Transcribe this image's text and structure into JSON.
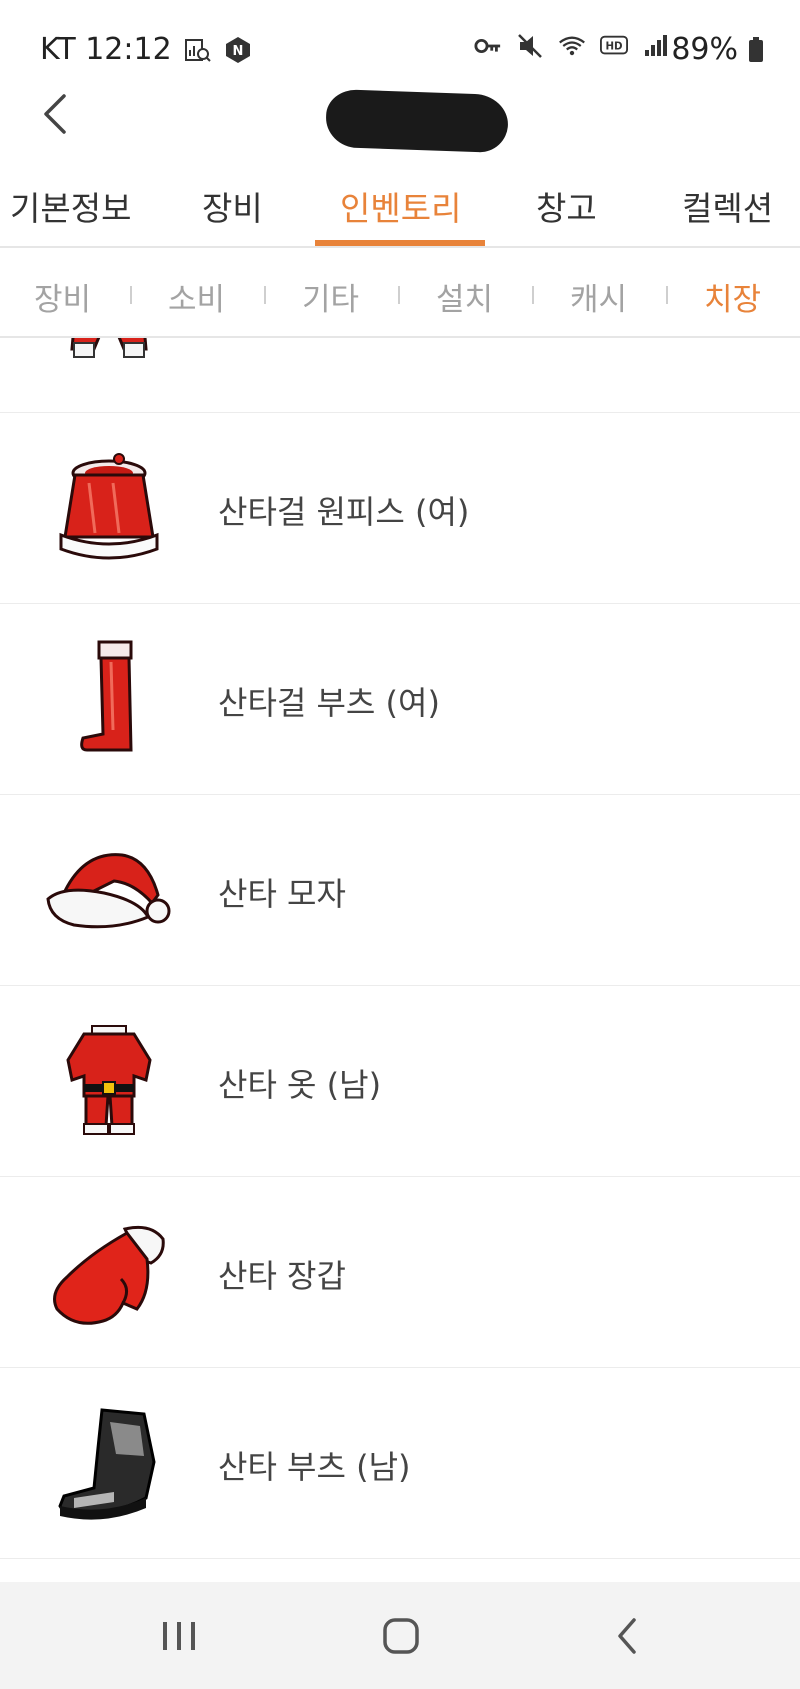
{
  "status_bar": {
    "carrier_time": "KT 12:12",
    "battery_percent": "89%",
    "left_icons": [
      "chart-search-icon",
      "naver-n-icon"
    ],
    "right_icons": [
      "key-icon",
      "mute-icon",
      "wifi-icon",
      "hd-icon",
      "signal-icon",
      "battery-icon"
    ]
  },
  "header": {
    "back_icon": "chevron-left-icon",
    "title_redacted": true
  },
  "main_tabs": [
    {
      "label": "기본정보",
      "active": false
    },
    {
      "label": "장비",
      "active": false
    },
    {
      "label": "인벤토리",
      "active": true
    },
    {
      "label": "창고",
      "active": false
    },
    {
      "label": "컬렉션",
      "active": false
    }
  ],
  "sub_tabs": [
    {
      "label": "장비",
      "active": false
    },
    {
      "label": "소비",
      "active": false
    },
    {
      "label": "기타",
      "active": false
    },
    {
      "label": "설치",
      "active": false
    },
    {
      "label": "캐시",
      "active": false
    },
    {
      "label": "치장",
      "active": true
    }
  ],
  "items": [
    {
      "name": "",
      "icon": "santa-pants-icon"
    },
    {
      "name": "산타걸 원피스 (여)",
      "icon": "santa-dress-icon"
    },
    {
      "name": "산타걸 부츠 (여)",
      "icon": "red-boot-icon"
    },
    {
      "name": "산타 모자",
      "icon": "santa-hat-icon"
    },
    {
      "name": "산타 옷 (남)",
      "icon": "santa-suit-icon"
    },
    {
      "name": "산타 장갑",
      "icon": "red-mitten-icon"
    },
    {
      "name": "산타 부츠 (남)",
      "icon": "black-boot-icon"
    }
  ],
  "nav_bar": {
    "buttons": [
      "recent-apps-icon",
      "home-icon",
      "back-icon"
    ]
  },
  "colors": {
    "accent": "#e8833a",
    "inactive_sub_tab": "#a3a3a3",
    "divider": "#e6e6e6",
    "nav_bg": "#f3f3f3"
  }
}
